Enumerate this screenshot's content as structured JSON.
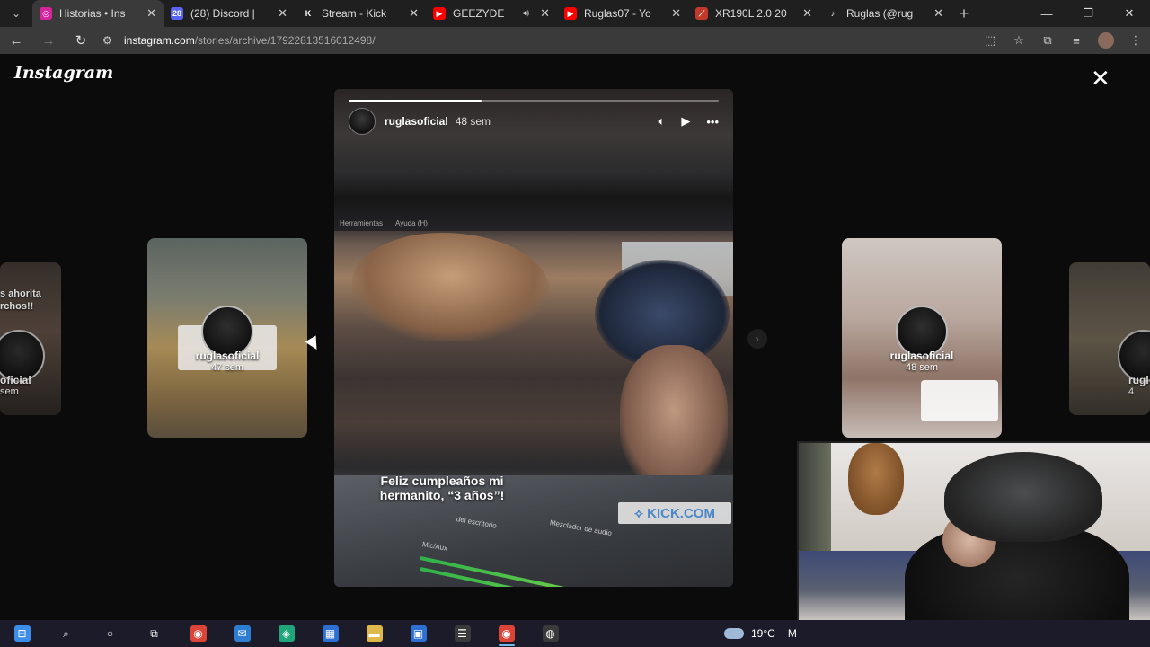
{
  "browser": {
    "tabs": [
      {
        "title": "Historias • Ins",
        "favicon_color": "#d6249f",
        "favicon_glyph": "◎",
        "active": true
      },
      {
        "title": "(28) Discord |",
        "favicon_color": "#5865f2",
        "favicon_glyph": "28",
        "active": false
      },
      {
        "title": "Stream - Kick",
        "favicon_color": "#1f1f1f",
        "favicon_glyph": "K",
        "active": false
      },
      {
        "title": "GEEZYDE",
        "favicon_color": "#ff0000",
        "favicon_glyph": "▶",
        "active": false,
        "audio": true
      },
      {
        "title": "Ruglas07 - Yo",
        "favicon_color": "#ff0000",
        "favicon_glyph": "▶",
        "active": false
      },
      {
        "title": "XR190L 2.0 20",
        "favicon_color": "#c0392b",
        "favicon_glyph": "⟋",
        "active": false
      },
      {
        "title": "Ruglas (@rug",
        "favicon_color": "#1f1f1f",
        "favicon_glyph": "♪",
        "active": false
      }
    ],
    "url_host": "instagram.com",
    "url_path": "/stories/archive/17922813516012498/"
  },
  "instagram": {
    "logo": "Instagram",
    "story": {
      "username": "ruglasoficial",
      "age": "48 sem",
      "progress": 0.36,
      "menu_items": [
        "Herramientas",
        "Ayuda (H)"
      ],
      "caption": "Feliz cumpleaños mi hermanito, “3 años”!",
      "badge": "⟡ KICK.COM",
      "mixer_labels": [
        "del escritorio",
        "Mezclador de audio",
        "Mic/Aux"
      ]
    },
    "previews": {
      "far_left": {
        "username": "ruglаsoficial",
        "username_display": "ruglasoficial",
        "name_visible": "oficial",
        "age_visible": "sem",
        "top_text": "s ahorita\nrchos!!"
      },
      "left": {
        "username": "ruglasoficial",
        "age": "47 sem"
      },
      "right": {
        "username": "ruglasoficial",
        "age": "48 sem"
      },
      "far_right": {
        "name_visible": "rugl",
        "age_visible": "4"
      }
    }
  },
  "taskbar": {
    "items": [
      {
        "name": "start",
        "glyph": "⊞",
        "color": "#3c8ee8"
      },
      {
        "name": "search",
        "glyph": "⌕",
        "color": "#1c1b2a"
      },
      {
        "name": "cortana",
        "glyph": "○",
        "color": "#1c1b2a"
      },
      {
        "name": "task-view",
        "glyph": "⧉",
        "color": "#1c1b2a"
      },
      {
        "name": "chrome",
        "glyph": "◉",
        "color": "#db4437"
      },
      {
        "name": "mail",
        "glyph": "✉",
        "color": "#2d7dd2"
      },
      {
        "name": "app-green",
        "glyph": "◈",
        "color": "#1fa67a"
      },
      {
        "name": "store",
        "glyph": "▦",
        "color": "#2d6fd2"
      },
      {
        "name": "explorer",
        "glyph": "▬",
        "color": "#e0b84a"
      },
      {
        "name": "calendar",
        "glyph": "▣",
        "color": "#2d6fd2"
      },
      {
        "name": "app-white",
        "glyph": "☰",
        "color": "#3a3a3a"
      },
      {
        "name": "chrome-active",
        "glyph": "◉",
        "color": "#db4437"
      },
      {
        "name": "obs",
        "glyph": "◍",
        "color": "#3a3a3a"
      }
    ],
    "weather": "19°C",
    "weather_trail": "M"
  }
}
